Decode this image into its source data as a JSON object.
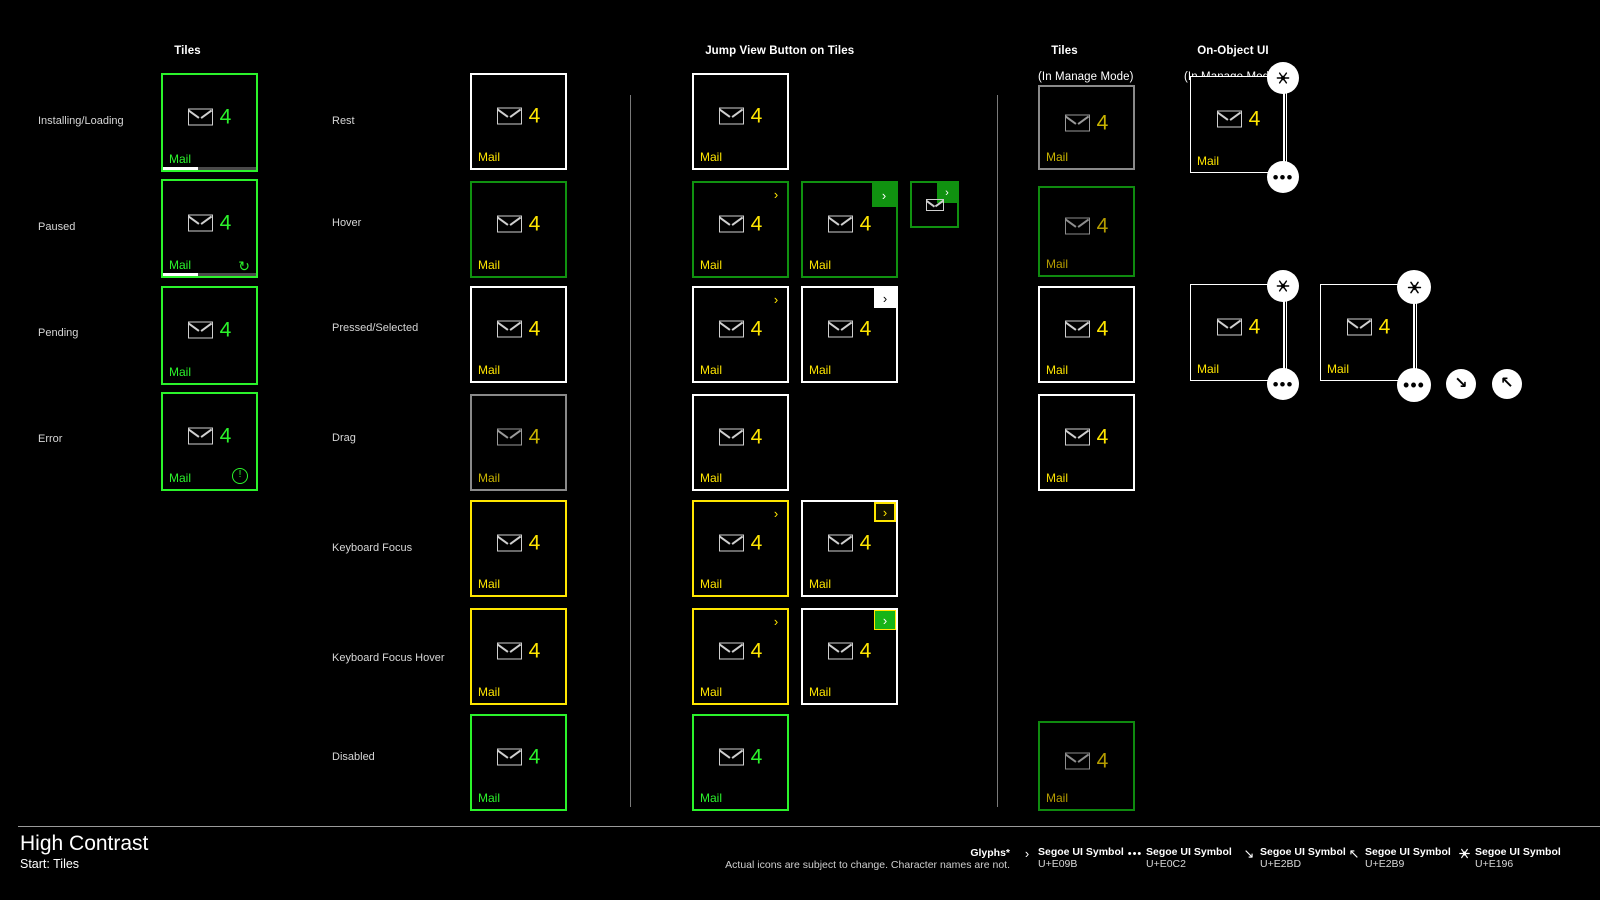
{
  "page": {
    "background": "#000000",
    "accent_green_bright": "#2bf32b",
    "accent_green_dark": "#109210",
    "accent_yellow": "#ffe600",
    "accent_white": "#ffffff",
    "accent_gray": "#8a8a8a"
  },
  "columns": {
    "tiles": {
      "title": "Tiles",
      "sub": ""
    },
    "states": {
      "title": "",
      "sub": ""
    },
    "jumpview": {
      "title": "Jump View Button on Tiles",
      "sub": ""
    },
    "tiles_manage": {
      "title": "Tiles",
      "sub": "(In Manage Mode)"
    },
    "onobject": {
      "title": "On-Object UI",
      "sub": "(In Manage Mode)"
    }
  },
  "status_rows": [
    {
      "label": "Installing/Loading"
    },
    {
      "label": "Paused"
    },
    {
      "label": "Pending"
    },
    {
      "label": "Error"
    }
  ],
  "state_rows": [
    {
      "label": "Rest"
    },
    {
      "label": "Hover"
    },
    {
      "label": "Pressed/Selected"
    },
    {
      "label": "Drag"
    },
    {
      "label": "Keyboard Focus"
    },
    {
      "label": "Keyboard Focus Hover"
    },
    {
      "label": "Disabled"
    }
  ],
  "tile": {
    "name": "Mail",
    "count": "4",
    "icon": "envelope-icon",
    "badge_refresh": "↻",
    "badge_error": "ⓘ"
  },
  "tiles": {
    "installing": {
      "name": "Mail",
      "count": "4",
      "progress_pct": 38
    },
    "paused": {
      "name": "Mail",
      "count": "4",
      "progress_pct": 38,
      "badge": "↻"
    },
    "pending": {
      "name": "Mail",
      "count": "4"
    },
    "error": {
      "name": "Mail",
      "count": "4",
      "badge": "!"
    },
    "rest": {
      "name": "Mail",
      "count": "4"
    },
    "hover": {
      "name": "Mail",
      "count": "4"
    },
    "pressed": {
      "name": "Mail",
      "count": "4"
    },
    "drag": {
      "name": "Mail",
      "count": "4"
    },
    "kbfocus": {
      "name": "Mail",
      "count": "4"
    },
    "kbfocushover": {
      "name": "Mail",
      "count": "4"
    },
    "disabled": {
      "name": "Mail",
      "count": "4"
    },
    "manage_rest": {
      "name": "Mail",
      "count": "4"
    },
    "manage_hover": {
      "name": "Mail",
      "count": "4"
    },
    "manage_pressed": {
      "name": "Mail",
      "count": "4"
    },
    "manage_drag": {
      "name": "Mail",
      "count": "4"
    },
    "manage_disabled": {
      "name": "Mail",
      "count": "4"
    },
    "onobject_1": {
      "name": "Mail",
      "count": "4"
    },
    "onobject_2": {
      "name": "Mail",
      "count": "4"
    },
    "onobject_3": {
      "name": "Mail",
      "count": "4"
    }
  },
  "jumpview_chevron": "›",
  "onobject_buttons": {
    "unpin": "unpin-icon",
    "more": "•••",
    "resize_larger": "↘",
    "resize_smaller": "↖"
  },
  "footer": {
    "title": "High Contrast",
    "subtitle": "Start: Tiles",
    "glyphs_label": "Glyphs*",
    "glyphs_note": "Actual icons are subject to change. Character names are not.",
    "glyphs": [
      {
        "symbol": "›",
        "icon_name": "chevron-right-icon",
        "font": "Segoe UI Symbol",
        "code": "U+E09B"
      },
      {
        "symbol": "•••",
        "icon_name": "ellipsis-icon",
        "font": "Segoe UI Symbol",
        "code": "U+E0C2"
      },
      {
        "symbol": "↘",
        "icon_name": "resize-larger-icon",
        "font": "Segoe UI Symbol",
        "code": "U+E2BD"
      },
      {
        "symbol": "↖",
        "icon_name": "resize-smaller-icon",
        "font": "Segoe UI Symbol",
        "code": "U+E2B9"
      },
      {
        "symbol": "unpin",
        "icon_name": "unpin-icon",
        "font": "Segoe UI Symbol",
        "code": "U+E196"
      }
    ]
  }
}
